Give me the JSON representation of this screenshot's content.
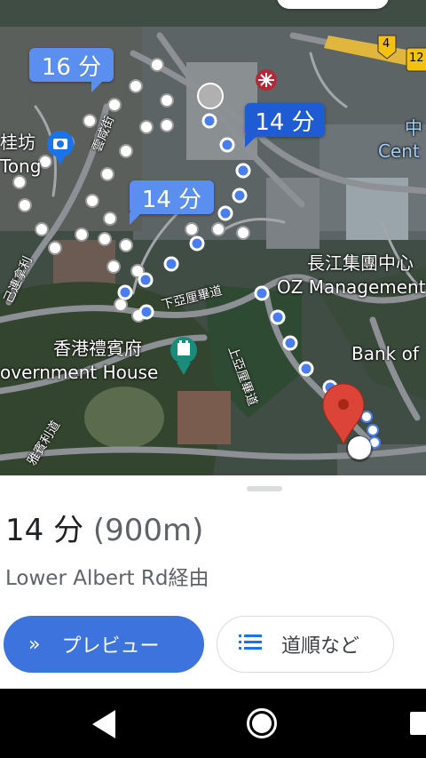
{
  "map": {
    "route_bubbles": [
      {
        "label": "16 分",
        "kind": "alternate"
      },
      {
        "label": "14 分",
        "kind": "primary"
      },
      {
        "label": "14 分",
        "kind": "alternate"
      }
    ],
    "labels": {
      "gui_fong": "桂坊",
      "tong": "Tong",
      "government_house_zh": "香港禮賓府",
      "government_house_en": "overnment House",
      "cheung_kong_zh": "長江集團中心",
      "cheung_kong_en": "OZ Management",
      "bank_of": "Bank of",
      "central_zh": "中",
      "central_en": "Cent",
      "route_badge": "4",
      "corner_badge": "12",
      "lower_albert_road": "下亞厘畢道",
      "upper_albert_road": "上亞厘畢道",
      "street_1": "雲咸街",
      "street_2": "己連拿利",
      "street_3": "雅賓利道"
    },
    "icons": [
      "camera-icon",
      "mtr-icon",
      "chess-rook-icon",
      "destination-pin-icon",
      "origin-dot-icon"
    ]
  },
  "sheet": {
    "duration": "14 分",
    "distance": "(900m)",
    "via": "Lower Albert Rd経由",
    "preview_button": "プレビュー",
    "steps_button": "道順など"
  },
  "colors": {
    "primary_route": "#4a7ef0",
    "alternate_route": "#bcbcbc",
    "primary_button": "#3d73dd",
    "pin": "#db4437"
  }
}
